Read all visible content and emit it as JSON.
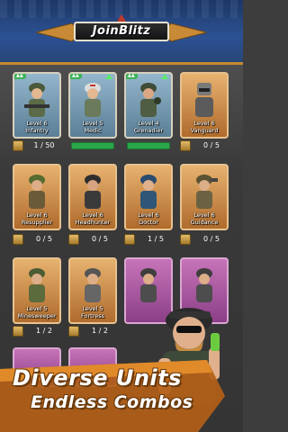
{
  "header": {
    "logo_text": "JoinBlitz"
  },
  "accent_colors": {
    "header_blue": "#2c5193",
    "gold": "#c6892e",
    "upgrade_green": "#2aa74a"
  },
  "units": [
    {
      "label": "Level 6\nInfantry",
      "progress": "1 / 50",
      "color": "blue",
      "icon": "infantry-soldier-icon",
      "badge": ""
    },
    {
      "label": "Level 5\nMedic",
      "progress": "",
      "upgrade": "",
      "color": "blue",
      "icon": "medic-soldier-icon",
      "badge": ""
    },
    {
      "label": "Level 4\nGrenadier",
      "progress": "",
      "upgrade": "",
      "color": "blue",
      "icon": "grenadier-soldier-icon",
      "badge": ""
    },
    {
      "label": "Level 6\nVanguard",
      "progress": "0 / 5",
      "color": "orange",
      "icon": "vanguard-soldier-icon"
    },
    {
      "label": "Level 6\nResupplier",
      "progress": "0 / 5",
      "color": "orange",
      "icon": "resupplier-soldier-icon"
    },
    {
      "label": "Level 6\nHeadhunter",
      "progress": "0 / 5",
      "color": "orange",
      "icon": "headhunter-soldier-icon"
    },
    {
      "label": "Level 6\nDoctor",
      "progress": "1 / 5",
      "color": "orange",
      "icon": "doctor-soldier-icon"
    },
    {
      "label": "Level 6\nGuidance",
      "progress": "0 / 5",
      "color": "orange",
      "icon": "guidance-soldier-icon"
    },
    {
      "label": "Level 5\nMinesweeper",
      "progress": "1 / 2",
      "color": "orange",
      "icon": "minesweeper-soldier-icon"
    },
    {
      "label": "Level 5\nFortress",
      "progress": "1 / 2",
      "color": "orange",
      "icon": "fortress-soldier-icon"
    },
    {
      "label": "",
      "progress": "",
      "color": "pink",
      "icon": "bazooka-soldier-icon"
    },
    {
      "label": "",
      "progress": "",
      "color": "pink",
      "icon": "sniper-soldier-icon"
    }
  ],
  "banner": {
    "line1": "Diverse Units",
    "line2": "Endless Combos"
  }
}
